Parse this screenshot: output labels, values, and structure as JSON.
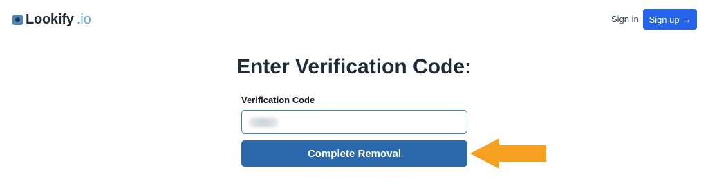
{
  "header": {
    "logo_name": "Lookify",
    "logo_tld": ".io",
    "signin_label": "Sign in",
    "signup_label": "Sign up",
    "signup_arrow": "→"
  },
  "main": {
    "title": "Enter Verification Code:",
    "field_label": "Verification Code",
    "code_value": "",
    "submit_label": "Complete Removal"
  },
  "colors": {
    "primary": "#2563eb",
    "submit": "#2b69ac",
    "arrow": "#f5a020",
    "brand_accent": "#5fa6d6"
  },
  "icons": {
    "logo": "logo-mark-icon",
    "arrow": "arrow-right-icon",
    "pointer": "orange-pointer-arrow-icon"
  }
}
